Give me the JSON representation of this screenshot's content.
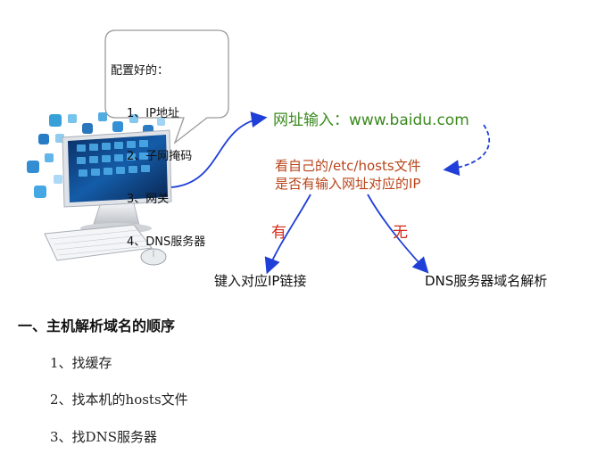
{
  "bubble": {
    "title": "配置好的：",
    "items": [
      "1、IP地址",
      "2、子网掩码",
      "3、网关",
      "4、DNS服务器"
    ]
  },
  "input_label": "网址输入：www.baidu.com",
  "check_label": [
    "看自己的/etc/hosts文件",
    "是否有输入网址对应的IP"
  ],
  "yes_label": "有",
  "no_label": "无",
  "yes_result": "键入对应IP链接",
  "no_result": "DNS服务器域名解析",
  "section": {
    "heading": "一、主机解析域名的顺序",
    "steps": [
      "1、找缓存",
      "2、找本机的hosts文件",
      "3、找DNS服务器"
    ]
  },
  "colors": {
    "arrow": "#1f3fd8",
    "input_text": "#3a8a1e",
    "check_text": "#b8441a",
    "branch_text": "#d42a1a"
  }
}
